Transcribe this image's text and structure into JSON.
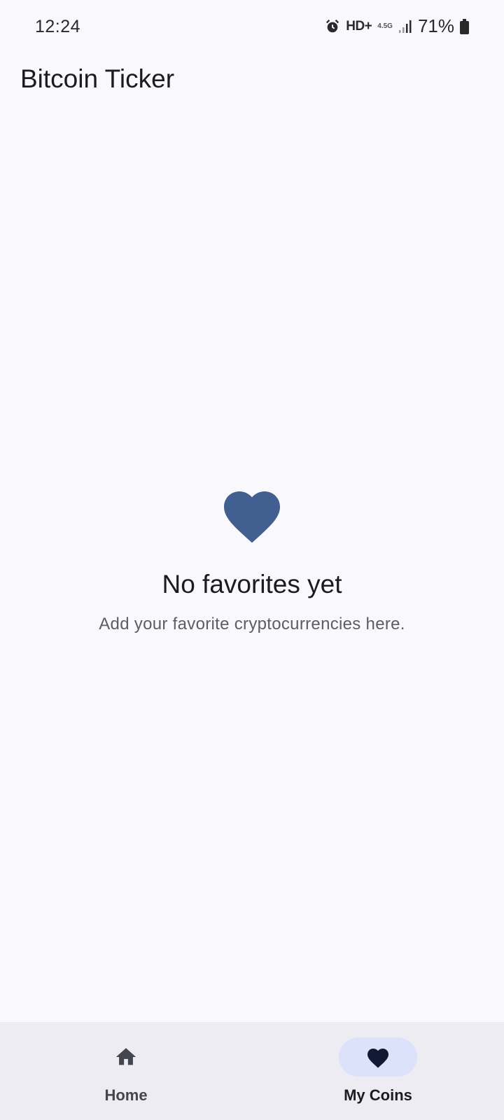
{
  "status_bar": {
    "time": "12:24",
    "alarm_icon": "alarm-icon",
    "hd_label": "HD+",
    "network_label": "4.5G",
    "signal_icon": "signal-icon",
    "battery_percent": "71%",
    "battery_icon": "battery-icon"
  },
  "app_bar": {
    "title": "Bitcoin Ticker"
  },
  "empty_state": {
    "icon": "heart-icon",
    "icon_color": "#415f91",
    "title": "No favorites yet",
    "subtitle": "Add your favorite cryptocurrencies here."
  },
  "bottom_nav": {
    "items": [
      {
        "label": "Home",
        "icon": "home-icon",
        "selected": false
      },
      {
        "label": "My Coins",
        "icon": "heart-icon",
        "selected": true
      }
    ],
    "active_pill_color": "#dbe2f9"
  },
  "colors": {
    "background": "#f9f8fd",
    "nav_background": "#eeecf3"
  }
}
